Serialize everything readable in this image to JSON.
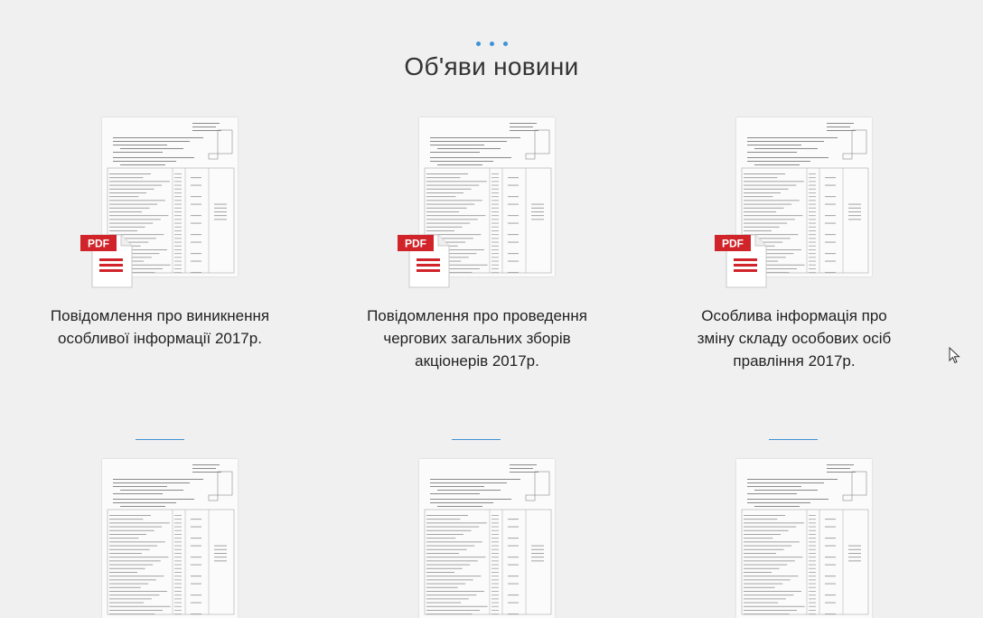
{
  "section": {
    "title": "Об'яви новини",
    "decor_icon": "ellipsis-dots-icon"
  },
  "pdf_badge": "PDF",
  "announcements": [
    {
      "title": "Повідомлення про виникнення особливої інформації 2017р."
    },
    {
      "title": "Повідомлення про проведення чергових загальних зборів акціонерів 2017р."
    },
    {
      "title": "Особлива інформація про зміну складу особових осіб правління 2017р."
    }
  ],
  "colors": {
    "background": "#f0f0f0",
    "accent": "#3f93d6",
    "pdf_red": "#d0242a"
  }
}
